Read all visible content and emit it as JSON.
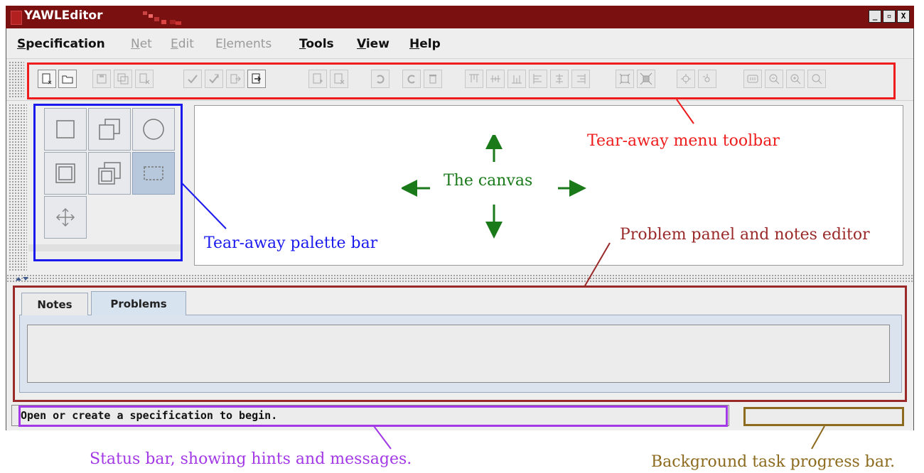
{
  "window": {
    "title": "YAWLEditor",
    "buttons": [
      "_",
      "▫",
      "X"
    ]
  },
  "menu": {
    "items": [
      {
        "label": "Specification",
        "mnemonic": "S",
        "rest": "pecification",
        "enabled": true
      },
      {
        "label": "Net",
        "mnemonic": "N",
        "rest": "et",
        "enabled": false
      },
      {
        "label": "Edit",
        "mnemonic": "E",
        "rest": "dit",
        "enabled": false
      },
      {
        "label": "Elements",
        "mnemonic": "l",
        "prefix": "E",
        "rest": "ements",
        "enabled": false
      },
      {
        "label": "Tools",
        "mnemonic": "T",
        "rest": "ools",
        "enabled": true
      },
      {
        "label": "View",
        "mnemonic": "V",
        "rest": "iew",
        "enabled": true
      },
      {
        "label": "Help",
        "mnemonic": "H",
        "rest": "elp",
        "enabled": true
      }
    ]
  },
  "toolbar": {
    "icons": [
      "new-spec-icon",
      "open-spec-icon",
      "save-icon",
      "save-as-icon",
      "close-spec-icon",
      "validate-icon",
      "analyse-icon",
      "export-icon",
      "import-icon",
      "add-net-icon",
      "remove-net-icon",
      "undo-icon",
      "redo-icon",
      "delete-icon",
      "align-top-icon",
      "align-center-icon",
      "align-bottom-icon",
      "align-left-icon",
      "align-middle-icon",
      "align-right-icon",
      "increase-size-icon",
      "decrease-size-icon",
      "cut-icon",
      "copy-icon",
      "zoom-actual-icon",
      "zoom-out-icon",
      "zoom-in-icon",
      "zoom-fit-icon"
    ]
  },
  "palette": {
    "tools": [
      "atomic-task-icon",
      "multiple-atomic-task-icon",
      "condition-icon",
      "composite-task-icon",
      "multiple-composite-task-icon",
      "marquee-select-icon",
      "drag-icon"
    ],
    "selected": "marquee-select-icon"
  },
  "tabs": [
    {
      "label": "Notes",
      "selected": false
    },
    {
      "label": "Problems",
      "selected": true
    }
  ],
  "status": {
    "message": "Open or create a specification to begin.",
    "progress": 0
  },
  "annotations": {
    "toolbar": "Tear-away menu toolbar",
    "canvas": "The canvas",
    "palette": "Tear-away palette bar",
    "problem_panel": "Problem panel and notes editor",
    "status_bar": "Status bar, showing hints and messages.",
    "progress_bar": "Background task progress bar."
  },
  "colors": {
    "title_bar": "#7a1010",
    "toolbar_annotation": "#ee1c1c",
    "palette_annotation": "#1a1aee",
    "canvas_annotation": "#1a7a1a",
    "problem_annotation": "#9a2a2a",
    "status_annotation": "#a238e6",
    "progress_annotation": "#8c6a1e"
  }
}
